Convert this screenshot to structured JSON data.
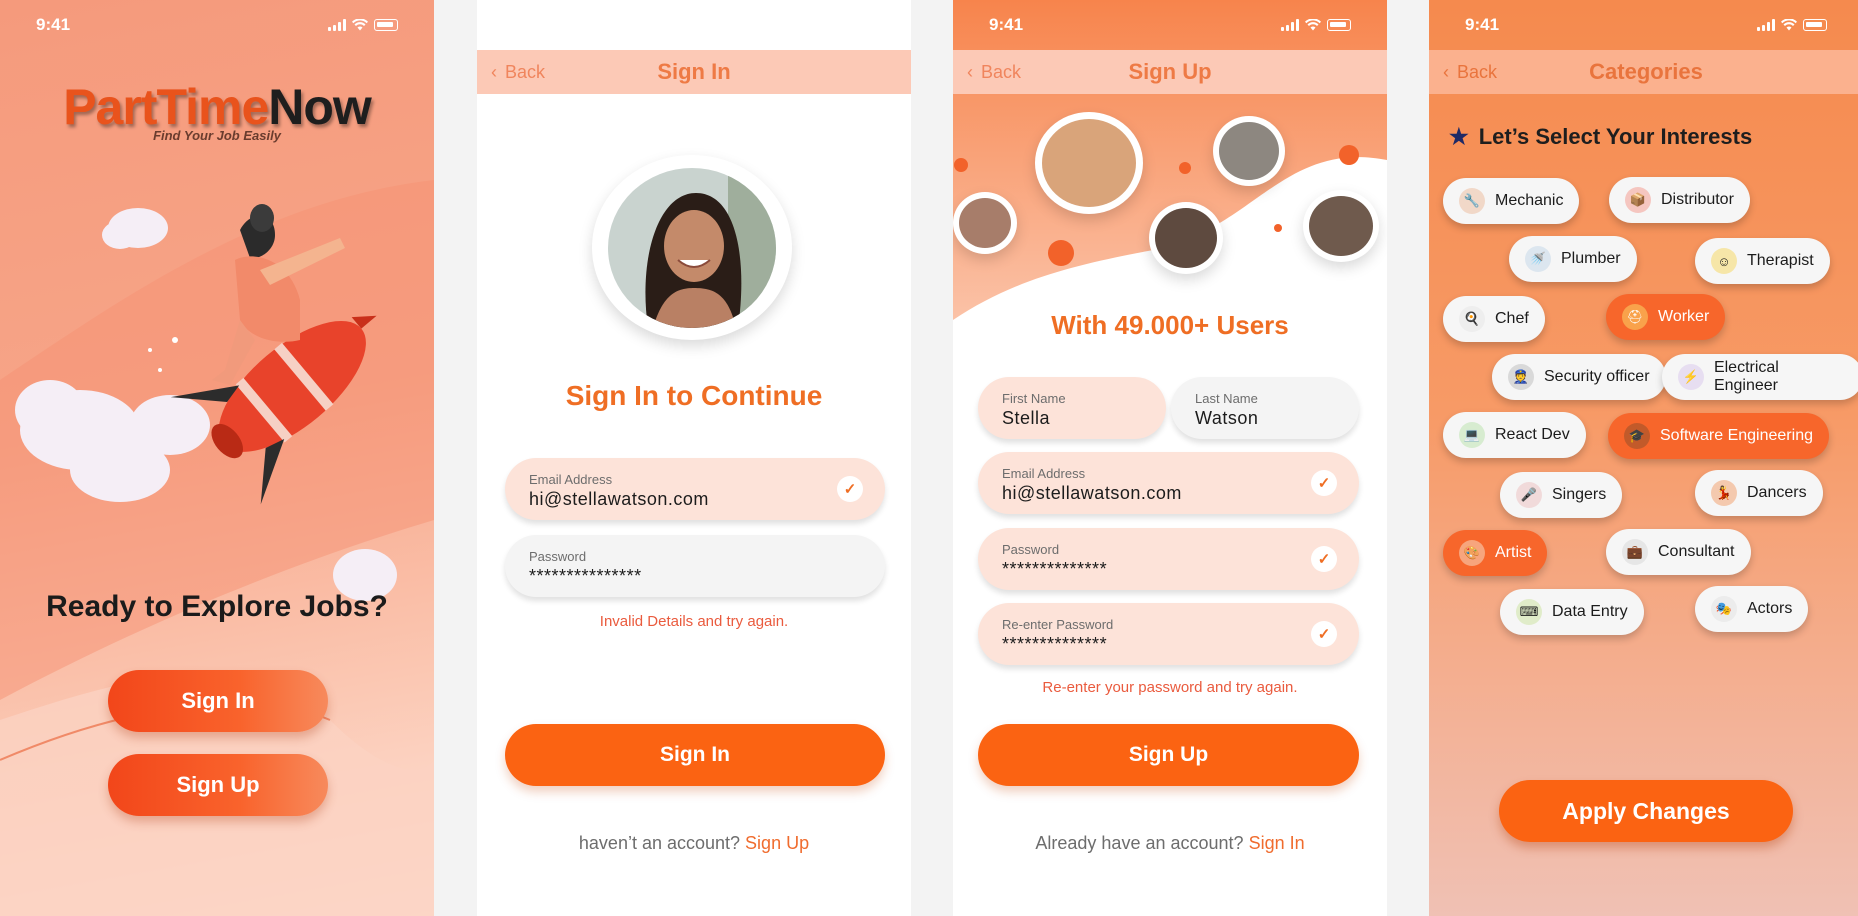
{
  "status_time": "9:41",
  "welcome": {
    "logo_part1": "PartTime",
    "logo_part2": "Now",
    "tagline": "Find Your Job Easily",
    "headline": "Ready to Explore Jobs?",
    "signin_button": "Sign In",
    "signup_button": "Sign Up"
  },
  "signin": {
    "back": "Back",
    "title": "Sign In",
    "heading": "Sign In to Continue",
    "email_label": "Email Address",
    "email_value": "hi@stellawatson.com",
    "password_label": "Password",
    "password_value": "***************",
    "error": "Invalid Details and try again.",
    "button": "Sign In",
    "footer_text": "haven’t an account?",
    "footer_link": "Sign Up"
  },
  "signup": {
    "back": "Back",
    "title": "Sign Up",
    "heading": "With 49.000+ Users",
    "first_name_label": "First Name",
    "first_name_value": "Stella",
    "last_name_label": "Last Name",
    "last_name_value": "Watson",
    "email_label": "Email Address",
    "email_value": "hi@stellawatson.com",
    "password_label": "Password",
    "password_value": "**************",
    "reenter_label": "Re-enter Password",
    "reenter_value": "**************",
    "error": "Re-enter your password and try again.",
    "button": "Sign Up",
    "footer_text": "Already have an account?",
    "footer_link": "Sign In"
  },
  "categories": {
    "back": "Back",
    "title": "Categories",
    "heading": "Let’s Select Your Interests",
    "chips": [
      {
        "label": "Mechanic",
        "selected": false
      },
      {
        "label": "Distributor",
        "selected": false
      },
      {
        "label": "Plumber",
        "selected": false
      },
      {
        "label": "Therapist",
        "selected": false
      },
      {
        "label": "Chef",
        "selected": false
      },
      {
        "label": "Worker",
        "selected": true
      },
      {
        "label": "Security officer",
        "selected": false
      },
      {
        "label": "Electrical Engineer",
        "selected": false
      },
      {
        "label": "React Dev",
        "selected": false
      },
      {
        "label": "Software Engineering",
        "selected": true
      },
      {
        "label": "Singers",
        "selected": false
      },
      {
        "label": "Dancers",
        "selected": false
      },
      {
        "label": "Artist",
        "selected": true
      },
      {
        "label": "Consultant",
        "selected": false
      },
      {
        "label": "Data Entry",
        "selected": false
      },
      {
        "label": "Actors",
        "selected": false
      }
    ],
    "apply_button": "Apply Changes"
  },
  "colors": {
    "accent": "#fb6312",
    "peach": "#fde3d9",
    "nav_bg": "#fcc9b6"
  }
}
